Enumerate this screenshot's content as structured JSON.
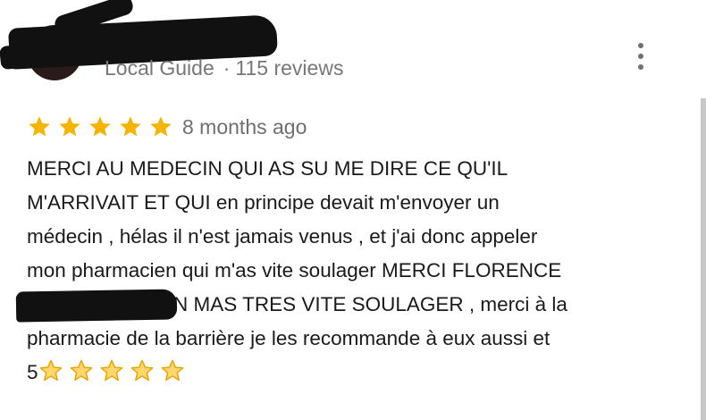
{
  "reviewer": {
    "badge": "Local Guide",
    "separator": "·",
    "review_count": "115 reviews"
  },
  "menu": {
    "icon": "more-vert-icon"
  },
  "rating": {
    "stars_value": 5,
    "stars_max": 5,
    "star_color": "#F4B400",
    "time": "8 months ago"
  },
  "review": {
    "line1": "MERCI AU MEDECIN QUI AS SU ME DIRE CE QU'IL",
    "line2": "M'ARRIVAIT  ET QUI en principe devait m'envoyer  un",
    "line3": "médecin , hélas il n'est jamais venus , et j'ai donc appeler",
    "line4": "mon pharmacien  qui m'as vite soulager MERCI FLORENCE",
    "line5_after_redaction": "N MAS TRES VITE SOULAGER , merci à la",
    "line6": "pharmacie  de la barrière je les recommande à eux aussi et",
    "line7_prefix": "5",
    "emoji_star_count": 5
  }
}
